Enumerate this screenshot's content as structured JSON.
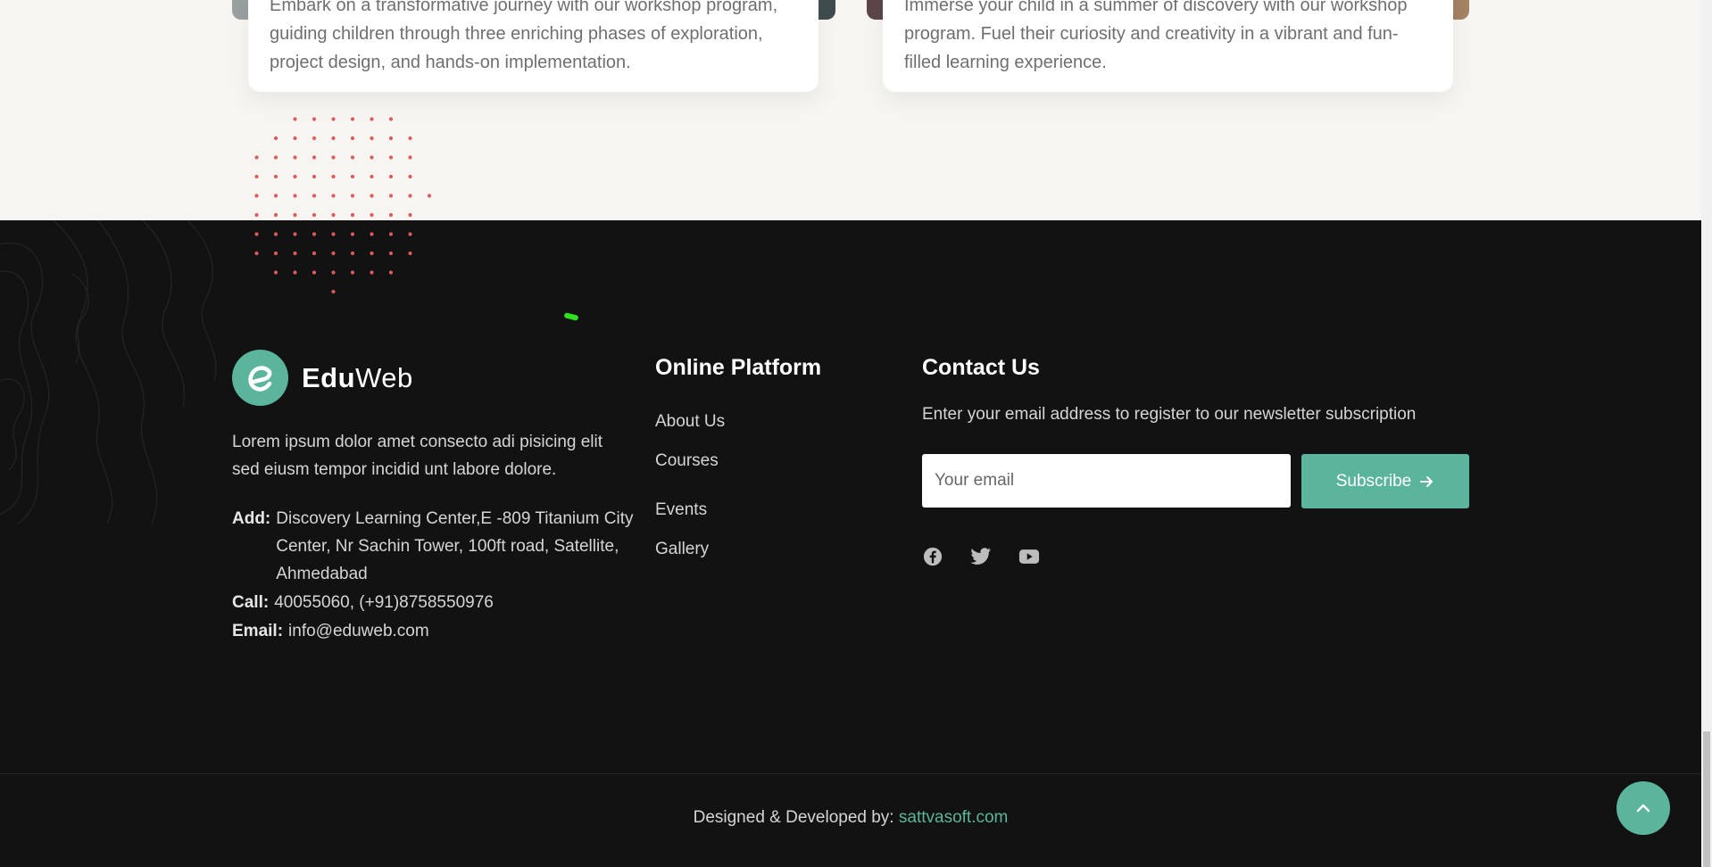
{
  "programs": {
    "left_card": {
      "clipped_line": "Embark on a transformative journey with our workshop program,",
      "text": "guiding children through three enriching phases of exploration, project design, and hands-on implementation."
    },
    "right_card": {
      "clipped_line": "Immerse your child in a summer of discovery with our workshop",
      "text": "program. Fuel their curiosity and creativity in a vibrant and fun-filled learning experience."
    }
  },
  "footer": {
    "brand": {
      "logo_icon": "e-letter-logo",
      "name_bold": "Edu",
      "name_light": "Web"
    },
    "about": "Lorem ipsum dolor amet consecto adi pisicing elit sed eiusm tempor incidid unt labore dolore.",
    "contact_info": {
      "address_label": "Add:",
      "address": "Discovery Learning Center,E -809 Titanium City Center, Nr Sachin Tower, 100ft road, Satellite, Ahmedabad",
      "call_label": "Call:",
      "call": "40055060, (+91)8758550976",
      "email_label": "Email:",
      "email": "info@eduweb.com"
    },
    "platform": {
      "title": "Online Platform",
      "links": [
        "About Us",
        "Courses",
        "Events",
        "Gallery"
      ]
    },
    "contact": {
      "title": "Contact Us",
      "newsletter_text": "Enter your email address to register to our newsletter subscription",
      "email_placeholder": "Your email",
      "subscribe_label": "Subscribe",
      "socials": [
        "facebook-icon",
        "twitter-icon",
        "youtube-icon"
      ]
    },
    "credit": {
      "prefix": "Designed & Developed by: ",
      "link": "sattvasoft.com"
    }
  },
  "colors": {
    "accent": "#5bb59c",
    "footer_bg": "#121212",
    "section_bg": "#f7f5f2",
    "dot_color": "#e05a5a"
  }
}
